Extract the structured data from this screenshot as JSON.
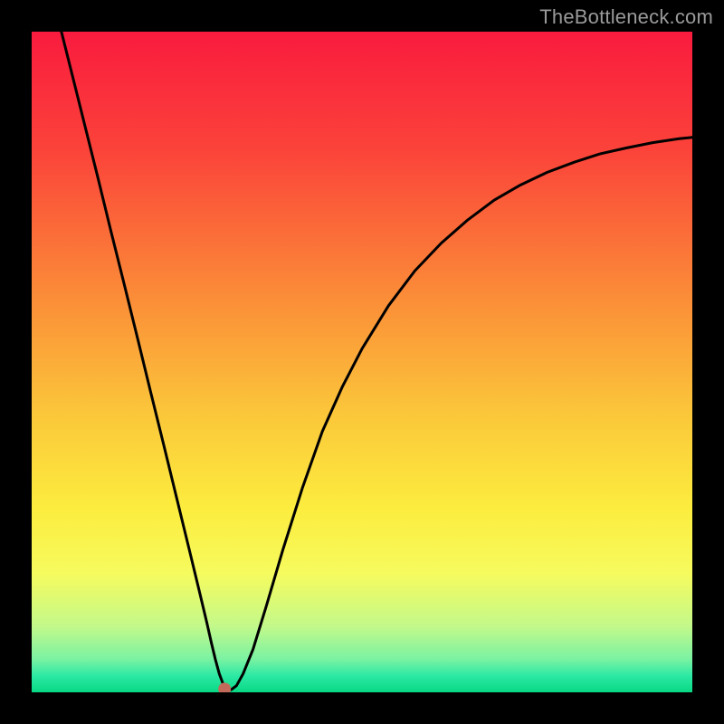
{
  "watermark": "TheBottleneck.com",
  "chart_data": {
    "type": "line",
    "title": "",
    "xlabel": "",
    "ylabel": "",
    "xlim": [
      0,
      1
    ],
    "ylim": [
      0,
      1
    ],
    "axes_visible": false,
    "grid": false,
    "legend": false,
    "background": {
      "kind": "vertical-gradient",
      "stops": [
        {
          "pos": 0.0,
          "color": "#f91b3e"
        },
        {
          "pos": 0.18,
          "color": "#fb433a"
        },
        {
          "pos": 0.4,
          "color": "#fb8c38"
        },
        {
          "pos": 0.58,
          "color": "#fbc73a"
        },
        {
          "pos": 0.72,
          "color": "#fcec3e"
        },
        {
          "pos": 0.82,
          "color": "#f6fb5e"
        },
        {
          "pos": 0.9,
          "color": "#c3f98a"
        },
        {
          "pos": 0.95,
          "color": "#7af2a2"
        },
        {
          "pos": 0.975,
          "color": "#2ce9a4"
        },
        {
          "pos": 1.0,
          "color": "#08d884"
        }
      ]
    },
    "min_marker": {
      "x": 0.292,
      "y": 0.005,
      "color": "#c36b5a",
      "radius_px": 7
    },
    "series": [
      {
        "name": "bottleneck-curve",
        "color": "#000000",
        "stroke_width_px": 3,
        "x": [
          0.045,
          0.06,
          0.08,
          0.1,
          0.12,
          0.14,
          0.16,
          0.18,
          0.2,
          0.22,
          0.24,
          0.255,
          0.265,
          0.272,
          0.278,
          0.284,
          0.29,
          0.296,
          0.302,
          0.31,
          0.32,
          0.335,
          0.355,
          0.38,
          0.41,
          0.44,
          0.47,
          0.5,
          0.54,
          0.58,
          0.62,
          0.66,
          0.7,
          0.74,
          0.78,
          0.82,
          0.86,
          0.9,
          0.94,
          0.98,
          1.0
        ],
        "y": [
          1.0,
          0.94,
          0.86,
          0.78,
          0.698,
          0.618,
          0.537,
          0.455,
          0.374,
          0.292,
          0.21,
          0.148,
          0.106,
          0.075,
          0.05,
          0.028,
          0.012,
          0.003,
          0.004,
          0.01,
          0.028,
          0.065,
          0.13,
          0.215,
          0.31,
          0.395,
          0.462,
          0.52,
          0.585,
          0.638,
          0.68,
          0.715,
          0.745,
          0.768,
          0.787,
          0.802,
          0.815,
          0.824,
          0.832,
          0.838,
          0.84
        ]
      }
    ]
  }
}
